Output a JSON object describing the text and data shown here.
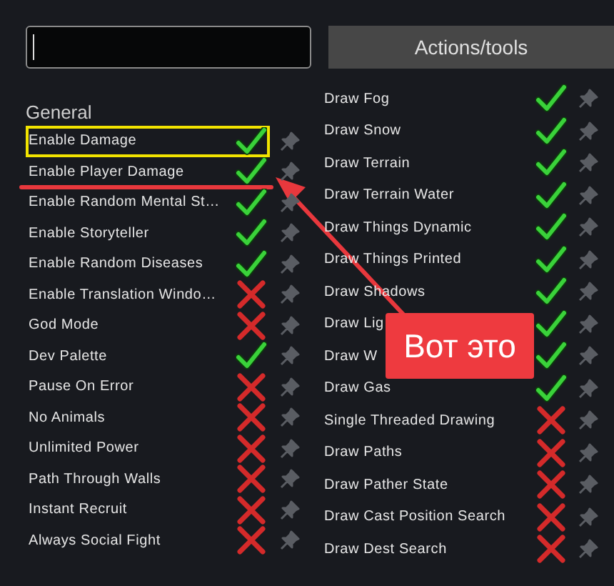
{
  "actions_button": "Actions/tools",
  "left": {
    "heading": "General",
    "rows": [
      {
        "label": "Enable Damage",
        "on": true,
        "highlighted": true
      },
      {
        "label": "Enable Player Damage",
        "on": true,
        "highlighted": false
      },
      {
        "label": "Enable Random Mental St…",
        "on": true,
        "highlighted": false
      },
      {
        "label": "Enable Storyteller",
        "on": true,
        "highlighted": false
      },
      {
        "label": "Enable Random Diseases",
        "on": true,
        "highlighted": false
      },
      {
        "label": "Enable Translation Windo…",
        "on": false,
        "highlighted": false
      },
      {
        "label": "God Mode",
        "on": false,
        "highlighted": false
      },
      {
        "label": "Dev Palette",
        "on": true,
        "highlighted": false
      },
      {
        "label": "Pause On Error",
        "on": false,
        "highlighted": false
      },
      {
        "label": "No Animals",
        "on": false,
        "highlighted": false
      },
      {
        "label": "Unlimited Power",
        "on": false,
        "highlighted": false
      },
      {
        "label": "Path Through Walls",
        "on": false,
        "highlighted": false
      },
      {
        "label": "Instant Recruit",
        "on": false,
        "highlighted": false
      },
      {
        "label": "Always Social Fight",
        "on": false,
        "highlighted": false
      }
    ]
  },
  "right": {
    "rows": [
      {
        "label": "Draw Fog",
        "on": true
      },
      {
        "label": "Draw Snow",
        "on": true
      },
      {
        "label": "Draw Terrain",
        "on": true
      },
      {
        "label": "Draw Terrain Water",
        "on": true
      },
      {
        "label": "Draw Things Dynamic",
        "on": true
      },
      {
        "label": "Draw Things Printed",
        "on": true
      },
      {
        "label": "Draw Shadows",
        "on": true
      },
      {
        "label": "Draw Lig",
        "on": true
      },
      {
        "label": "Draw W",
        "on": true
      },
      {
        "label": "Draw Gas",
        "on": true
      },
      {
        "label": "Single Threaded Drawing",
        "on": false
      },
      {
        "label": "Draw Paths",
        "on": false
      },
      {
        "label": "Draw Pather State",
        "on": false
      },
      {
        "label": "Draw Cast Position Search",
        "on": false
      },
      {
        "label": "Draw Dest Search",
        "on": false
      }
    ]
  },
  "callout": "Вот это"
}
